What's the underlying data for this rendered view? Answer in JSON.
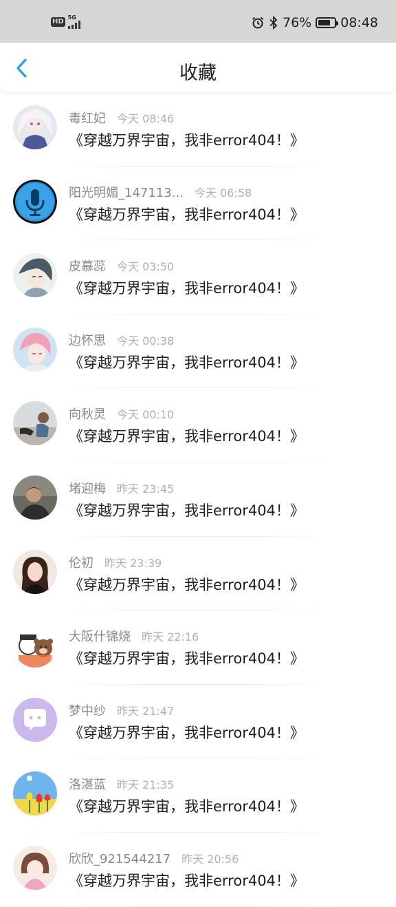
{
  "status_bar": {
    "hd": "HD",
    "network": "5G",
    "battery_text": "76%",
    "battery_level": 0.76,
    "time": "08:48",
    "icons": [
      "alarm-icon",
      "bluetooth-icon",
      "battery-icon",
      "signal-icon"
    ]
  },
  "nav": {
    "title": "收藏",
    "back_icon": "chevron-left-icon",
    "accent": "#2f9bf0"
  },
  "items": [
    {
      "name": "毒红妃",
      "time": "今天 08:46",
      "content": "《穿越万界宇宙，我非error404！》",
      "avatar": "anime-girl-white"
    },
    {
      "name": "阳光明媚_147113...",
      "time": "今天 06:58",
      "content": "《穿越万界宇宙，我非error404！》",
      "avatar": "microphone"
    },
    {
      "name": "皮慕蕊",
      "time": "今天 03:50",
      "content": "《穿越万界宇宙，我非error404！》",
      "avatar": "anime-sketch"
    },
    {
      "name": "边怀思",
      "time": "今天 00:38",
      "content": "《穿越万界宇宙，我非error404！》",
      "avatar": "pink-hair"
    },
    {
      "name": "向秋灵",
      "time": "今天 00:10",
      "content": "《穿越万界宇宙，我非error404！》",
      "avatar": "child-photo"
    },
    {
      "name": "堵迎梅",
      "time": "昨天 23:45",
      "content": "《穿越万界宇宙，我非error404！》",
      "avatar": "man-photo"
    },
    {
      "name": "伦初",
      "time": "昨天 23:39",
      "content": "《穿越万界宇宙，我非error404！》",
      "avatar": "woman-photo"
    },
    {
      "name": "大阪什锦烧",
      "time": "昨天 22:16",
      "content": "《穿越万界宇宙，我非error404！》",
      "avatar": "cartoon-bear"
    },
    {
      "name": "梦中纱",
      "time": "昨天 21:47",
      "content": "《穿越万界宇宙，我非error404！》",
      "avatar": "chat-bubble"
    },
    {
      "name": "洛湛蓝",
      "time": "昨天 21:35",
      "content": "《穿越万界宇宙，我非error404！》",
      "avatar": "tulips"
    },
    {
      "name": "欣欣_921544217",
      "time": "昨天 20:56",
      "content": "《穿越万界宇宙，我非error404！》",
      "avatar": "anime-girl-pink"
    }
  ]
}
